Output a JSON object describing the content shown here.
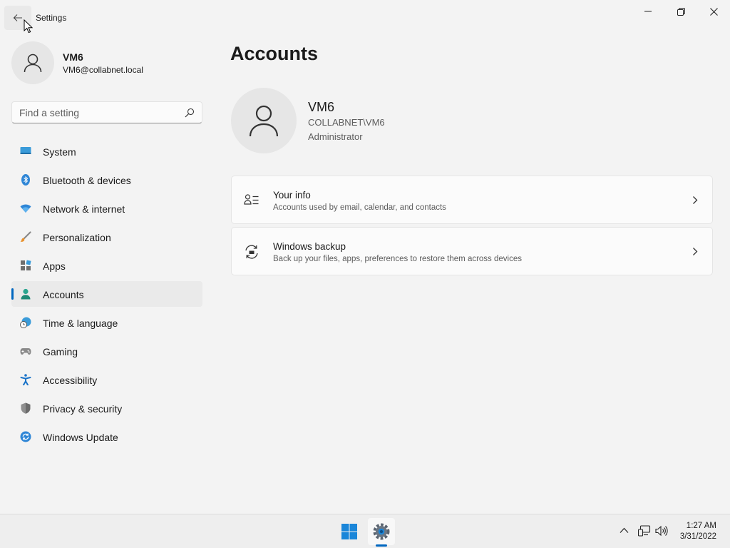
{
  "window": {
    "title": "Settings",
    "back_icon": "arrow-left-icon",
    "controls": [
      "minimize-icon",
      "restore-icon",
      "close-icon"
    ]
  },
  "profile": {
    "name": "VM6",
    "email": "VM6@collabnet.local",
    "avatar_icon": "person-icon"
  },
  "search": {
    "placeholder": "Find a setting",
    "icon": "search-icon"
  },
  "nav": {
    "items": [
      {
        "label": "System",
        "icon": "monitor-icon"
      },
      {
        "label": "Bluetooth & devices",
        "icon": "bluetooth-icon"
      },
      {
        "label": "Network & internet",
        "icon": "wifi-icon"
      },
      {
        "label": "Personalization",
        "icon": "brush-icon"
      },
      {
        "label": "Apps",
        "icon": "apps-icon"
      },
      {
        "label": "Accounts",
        "icon": "accounts-icon"
      },
      {
        "label": "Time & language",
        "icon": "globe-clock-icon"
      },
      {
        "label": "Gaming",
        "icon": "gamepad-icon"
      },
      {
        "label": "Accessibility",
        "icon": "accessibility-icon"
      },
      {
        "label": "Privacy & security",
        "icon": "shield-icon"
      },
      {
        "label": "Windows Update",
        "icon": "update-icon"
      }
    ],
    "active": "Accounts"
  },
  "main": {
    "title": "Accounts",
    "account": {
      "name": "VM6",
      "domain": "COLLABNET\\VM6",
      "role": "Administrator"
    },
    "cards": [
      {
        "title": "Your info",
        "subtitle": "Accounts used by email, calendar, and contacts",
        "icon": "contact-card-icon"
      },
      {
        "title": "Windows backup",
        "subtitle": "Back up your files, apps, preferences to restore them across devices",
        "icon": "backup-sync-icon"
      }
    ]
  },
  "taskbar": {
    "apps": [
      "windows-start-icon",
      "settings-gear-icon"
    ],
    "tray": [
      "chevron-up-icon",
      "network-icon",
      "speaker-icon"
    ],
    "time": "1:27 AM",
    "date": "3/31/2022"
  },
  "colors": {
    "accent": "#0067c0",
    "background": "#f3f3f3",
    "card": "#fbfbfb"
  }
}
